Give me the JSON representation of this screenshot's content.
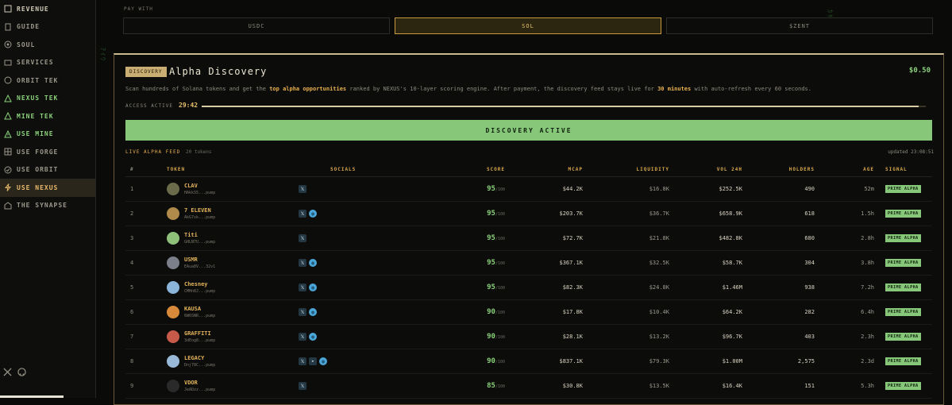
{
  "sidebar": {
    "items": [
      {
        "label": "REVENUE",
        "icon": "revenue-icon"
      },
      {
        "label": "GUIDE",
        "icon": "guide-icon"
      },
      {
        "label": "SOUL",
        "icon": "soul-icon"
      },
      {
        "label": "SERVICES",
        "icon": "services-icon"
      },
      {
        "label": "ORBIT TEK",
        "icon": "orbit-icon"
      },
      {
        "label": "NEXUS TEK",
        "icon": "nexus-icon"
      },
      {
        "label": "MINE TEK",
        "icon": "mine-icon"
      },
      {
        "label": "USE MINE",
        "icon": "warning-icon"
      },
      {
        "label": "USE FORGE",
        "icon": "grid-icon"
      },
      {
        "label": "USE ORBIT",
        "icon": "check-circle-icon"
      },
      {
        "label": "USE NEXUS",
        "icon": "bolt-icon"
      },
      {
        "label": "THE SYNAPSE",
        "icon": "building-icon"
      }
    ]
  },
  "pay": {
    "label": "PAY WITH",
    "options": [
      "USDC",
      "SOL",
      "$ZENT"
    ],
    "selected": "SOL"
  },
  "panel": {
    "tag": "DISCOVERY",
    "title": "Alpha Discovery",
    "price": "$0.50",
    "desc_1": "Scan hundreds of Solana tokens and get the ",
    "desc_hl1": "top alpha opportunities",
    "desc_2": " ranked by NEXUS's 10-layer scoring engine. After payment, the discovery feed stays live for ",
    "desc_hl2": "30 minutes",
    "desc_3": " with auto-refresh every 60 seconds.",
    "access_label": "ACCESS ACTIVE",
    "timer": "29:42",
    "progress": 0.99,
    "status_button": "DISCOVERY ACTIVE",
    "feed_label": "LIVE ALPHA FEED",
    "feed_count": "20 tokens",
    "updated": "updated 23:08:51"
  },
  "table": {
    "headers": [
      "#",
      "TOKEN",
      "SOCIALS",
      "SCORE",
      "MCAP",
      "LIQUIDITY",
      "VOL 24H",
      "HOLDERS",
      "AGE",
      "SIGNAL"
    ],
    "score_suffix": "/100",
    "rows": [
      {
        "n": "1",
        "name": "CLAV",
        "addr": "HAkkS5...pump",
        "socials": [
          "x"
        ],
        "score": "95",
        "mcap": "$44.2K",
        "liq": "$16.8K",
        "vol": "$252.5K",
        "holders": "490",
        "age": "52m",
        "signal": "PRIME ALPHA",
        "color": "#6b6a4a"
      },
      {
        "n": "2",
        "name": "7 ELEVEN",
        "addr": "AkG7sk...pump",
        "socials": [
          "x",
          "web"
        ],
        "score": "95",
        "mcap": "$203.7K",
        "liq": "$36.7K",
        "vol": "$658.9K",
        "holders": "618",
        "age": "1.5h",
        "signal": "PRIME ALPHA",
        "color": "#b08a4a"
      },
      {
        "n": "3",
        "name": "Titi",
        "addr": "GHLN7U...pump",
        "socials": [
          "x"
        ],
        "score": "95",
        "mcap": "$72.7K",
        "liq": "$21.8K",
        "vol": "$482.8K",
        "holders": "680",
        "age": "2.8h",
        "signal": "PRIME ALPHA",
        "color": "#8fc07a"
      },
      {
        "n": "4",
        "name": "USMR",
        "addr": "EAua8V...32v1",
        "socials": [
          "x",
          "web"
        ],
        "score": "95",
        "mcap": "$367.1K",
        "liq": "$32.5K",
        "vol": "$58.7K",
        "holders": "304",
        "age": "3.8h",
        "signal": "PRIME ALPHA",
        "color": "#7a7f8a"
      },
      {
        "n": "5",
        "name": "Chesney",
        "addr": "CMHn8J...pump",
        "socials": [
          "x",
          "web"
        ],
        "score": "95",
        "mcap": "$82.3K",
        "liq": "$24.8K",
        "vol": "$1.46M",
        "holders": "938",
        "age": "7.2h",
        "signal": "PRIME ALPHA",
        "color": "#8ab4d8"
      },
      {
        "n": "6",
        "name": "KAUSA",
        "addr": "6W6SNR...pump",
        "socials": [
          "x",
          "web"
        ],
        "score": "90",
        "mcap": "$17.8K",
        "liq": "$10.4K",
        "vol": "$64.2K",
        "holders": "282",
        "age": "6.4h",
        "signal": "PRIME ALPHA",
        "color": "#d88a3a"
      },
      {
        "n": "7",
        "name": "GRAFFITI",
        "addr": "3dEog8...pump",
        "socials": [
          "x",
          "web"
        ],
        "score": "90",
        "mcap": "$28.1K",
        "liq": "$13.2K",
        "vol": "$96.7K",
        "holders": "403",
        "age": "2.3h",
        "signal": "PRIME ALPHA",
        "color": "#c85a4a"
      },
      {
        "n": "8",
        "name": "LEGACY",
        "addr": "Dnj78C...pump",
        "socials": [
          "x",
          "tg",
          "web"
        ],
        "score": "90",
        "mcap": "$837.1K",
        "liq": "$79.3K",
        "vol": "$1.00M",
        "holders": "2,575",
        "age": "2.3d",
        "signal": "PRIME ALPHA",
        "color": "#9ab8d8"
      },
      {
        "n": "9",
        "name": "VDOR",
        "addr": "JeADzz...pump",
        "socials": [
          "x"
        ],
        "score": "85",
        "mcap": "$30.8K",
        "liq": "$13.5K",
        "vol": "$16.4K",
        "holders": "151",
        "age": "5.3h",
        "signal": "PRIME ALPHA",
        "color": "#2a2a2a"
      }
    ]
  }
}
